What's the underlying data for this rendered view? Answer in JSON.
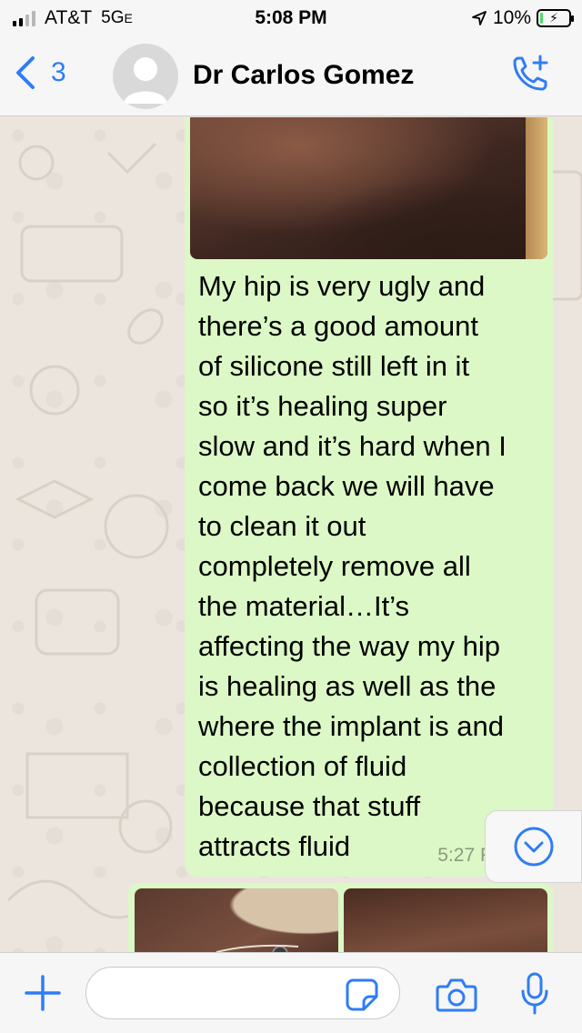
{
  "status_bar": {
    "carrier": "AT&T",
    "network": "5G",
    "network_suffix": "E",
    "time": "5:08 PM",
    "battery": "10%",
    "battery_level": 0.1
  },
  "header": {
    "back_count": "3",
    "contact_name": "Dr Carlos Gomez"
  },
  "chat": {
    "message": {
      "text": "My hip is very ugly and\nthere’s a good amount\nof silicone still left in it\nso it’s healing super\nslow and it’s hard when I\ncome back we will have\nto clean it out\ncompletely remove all\nthe material…It’s\naffecting the way my hip\nis healing as well as the\nwhere the implant is and\ncollection of fluid\nbecause that stuff\nattracts fluid",
      "time": "5:27 P"
    }
  },
  "input": {
    "placeholder": "",
    "value": ""
  },
  "icons": {
    "back": "chevron-left-icon",
    "avatar": "avatar-placeholder-icon",
    "call": "add-call-icon",
    "scroll": "scroll-down-icon",
    "attach": "plus-icon",
    "sticker": "sticker-icon",
    "camera": "camera-icon",
    "mic": "microphone-icon"
  },
  "colors": {
    "accent": "#2f7cf6",
    "outgoing_bubble": "#dcf8c6",
    "chat_background": "#ece5dd",
    "battery_fill": "#4cd964"
  }
}
